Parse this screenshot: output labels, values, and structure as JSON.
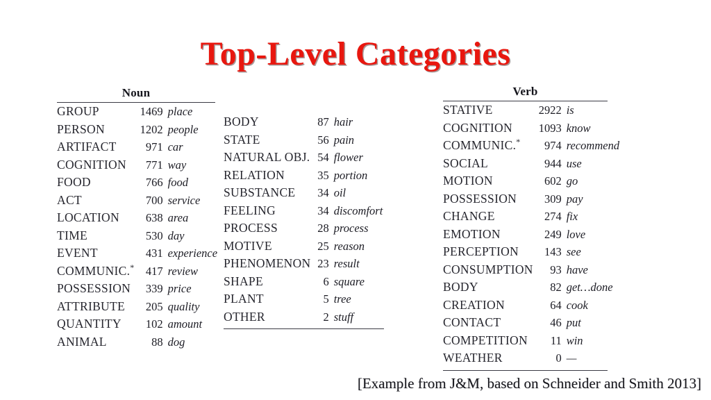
{
  "title": "Top-Level Categories",
  "caption": "[Example from J&M, based on Schneider and Smith 2013]",
  "colors": {
    "title_red": "#e8170f",
    "text": "#1c1c24",
    "rule": "#3a3a44",
    "background": "#ffffff"
  },
  "columns": {
    "noun": {
      "header": "Noun",
      "has_header_rule": true,
      "has_bottom_rule": false,
      "rows": [
        {
          "category": "GROUP",
          "count": "1469",
          "example": "place"
        },
        {
          "category": "PERSON",
          "count": "1202",
          "example": "people"
        },
        {
          "category": "ARTIFACT",
          "count": "971",
          "example": "car"
        },
        {
          "category": "COGNITION",
          "count": "771",
          "example": "way"
        },
        {
          "category": "FOOD",
          "count": "766",
          "example": "food"
        },
        {
          "category": "ACT",
          "count": "700",
          "example": "service"
        },
        {
          "category": "LOCATION",
          "count": "638",
          "example": "area"
        },
        {
          "category": "TIME",
          "count": "530",
          "example": "day"
        },
        {
          "category": "EVENT",
          "count": "431",
          "example": "experience"
        },
        {
          "category": "COMMUNIC.",
          "star": "*",
          "count": "417",
          "example": "review"
        },
        {
          "category": "POSSESSION",
          "count": "339",
          "example": "price"
        },
        {
          "category": "ATTRIBUTE",
          "count": "205",
          "example": "quality"
        },
        {
          "category": "QUANTITY",
          "count": "102",
          "example": "amount"
        },
        {
          "category": "ANIMAL",
          "count": "88",
          "example": "dog"
        }
      ]
    },
    "noun_continued": {
      "header": "",
      "has_header_rule": false,
      "has_bottom_rule": true,
      "rows": [
        {
          "category": "BODY",
          "count": "87",
          "example": "hair"
        },
        {
          "category": "STATE",
          "count": "56",
          "example": "pain"
        },
        {
          "category": "NATURAL OBJ.",
          "count": "54",
          "example": "flower"
        },
        {
          "category": "RELATION",
          "count": "35",
          "example": "portion"
        },
        {
          "category": "SUBSTANCE",
          "count": "34",
          "example": "oil"
        },
        {
          "category": "FEELING",
          "count": "34",
          "example": "discomfort"
        },
        {
          "category": "PROCESS",
          "count": "28",
          "example": "process"
        },
        {
          "category": "MOTIVE",
          "count": "25",
          "example": "reason"
        },
        {
          "category": "PHENOMENON",
          "count": "23",
          "example": "result"
        },
        {
          "category": "SHAPE",
          "count": "6",
          "example": "square"
        },
        {
          "category": "PLANT",
          "count": "5",
          "example": "tree"
        },
        {
          "category": "OTHER",
          "count": "2",
          "example": "stuff"
        }
      ]
    },
    "verb": {
      "header": "Verb",
      "has_header_rule": true,
      "has_bottom_rule": true,
      "rows": [
        {
          "category": "STATIVE",
          "count": "2922",
          "example": "is"
        },
        {
          "category": "COGNITION",
          "count": "1093",
          "example": "know"
        },
        {
          "category": "COMMUNIC.",
          "star": "*",
          "count": "974",
          "example": "recommend"
        },
        {
          "category": "SOCIAL",
          "count": "944",
          "example": "use"
        },
        {
          "category": "MOTION",
          "count": "602",
          "example": "go"
        },
        {
          "category": "POSSESSION",
          "count": "309",
          "example": "pay"
        },
        {
          "category": "CHANGE",
          "count": "274",
          "example": "fix"
        },
        {
          "category": "EMOTION",
          "count": "249",
          "example": "love"
        },
        {
          "category": "PERCEPTION",
          "count": "143",
          "example": "see"
        },
        {
          "category": "CONSUMPTION",
          "count": "93",
          "example": "have"
        },
        {
          "category": "BODY",
          "count": "82",
          "example": "get…done"
        },
        {
          "category": "CREATION",
          "count": "64",
          "example": "cook"
        },
        {
          "category": "CONTACT",
          "count": "46",
          "example": "put"
        },
        {
          "category": "COMPETITION",
          "count": "11",
          "example": "win"
        },
        {
          "category": "WEATHER",
          "count": "0",
          "example": "—"
        }
      ]
    }
  }
}
